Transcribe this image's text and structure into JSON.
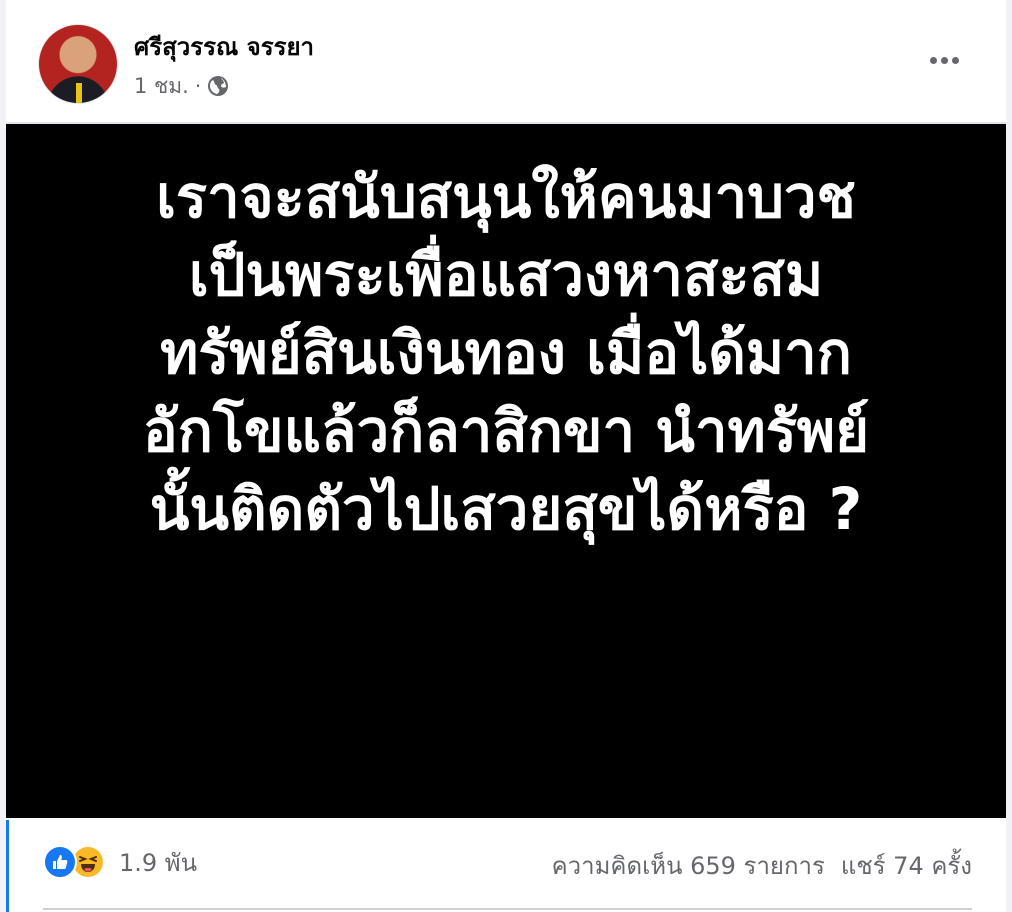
{
  "post": {
    "author": "ศรีสุวรรณ จรรยา",
    "time": "1 ชม.",
    "separator": "·",
    "privacy_icon": "globe-icon",
    "more_icon": "more-options-icon",
    "image_text_lines": [
      "เราจะสนับสนุนให้คนมาบวช",
      "เป็นพระเพื่อแสวงหาสะสม",
      "ทรัพย์สินเงินทอง เมื่อได้มาก",
      "อักโขแล้วก็ลาสิกขา นำทรัพย์",
      "นั้นติดตัวไปเสวยสุขได้หรือ ?"
    ]
  },
  "reactions": {
    "icons": [
      "like-icon",
      "haha-icon"
    ],
    "count": "1.9 พัน"
  },
  "stats": {
    "comments": "ความคิดเห็น 659 รายการ",
    "shares": "แชร์ 74 ครั้ง"
  },
  "colors": {
    "accent": "#1877f2",
    "secondary_text": "#65676b",
    "image_background": "#000000",
    "image_text": "#ffffff"
  }
}
